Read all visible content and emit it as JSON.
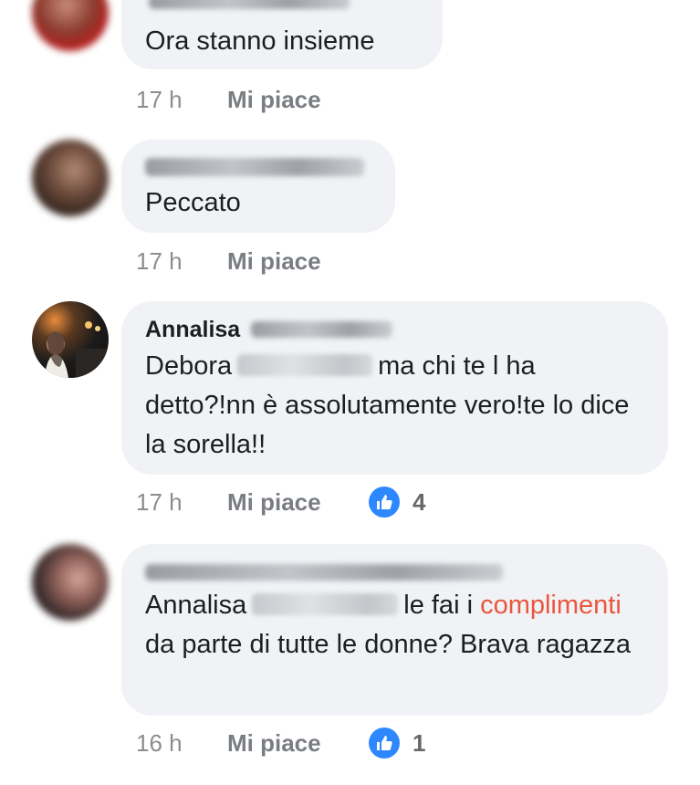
{
  "comments": [
    {
      "author": "",
      "text": "Ora stanno insieme",
      "time": "17 h",
      "like_label": "Mi piace",
      "reactions": ""
    },
    {
      "author": "",
      "text": "Peccato",
      "time": "17 h",
      "like_label": "Mi piace",
      "reactions": ""
    },
    {
      "author": "Annalisa",
      "text_before": "Debora",
      "text_after": "ma chi te l ha detto?!nn è assolutamente vero!te lo dice la sorella!!",
      "time": "17 h",
      "like_label": "Mi piace",
      "reactions": "4"
    },
    {
      "author": "",
      "text_before": "Annalisa",
      "text_mid": "le fai i",
      "highlight": "complimenti",
      "text_after": "da parte di tutte le donne? Brava ragazza",
      "time": "16 h",
      "like_label": "Mi piace",
      "reactions": "1"
    }
  ],
  "colors": {
    "bubble": "#f0f2f5",
    "meta": "#8a8d91",
    "reaction_badge": "#2d88ff",
    "highlight": "#e9573f"
  },
  "icons": [
    "avatar-photo",
    "like-thumb-icon"
  ]
}
